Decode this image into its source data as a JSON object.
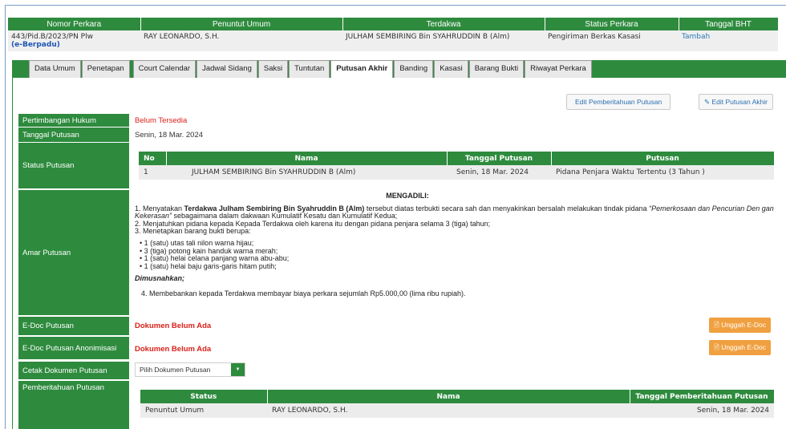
{
  "case": {
    "headers": [
      "Nomor Perkara",
      "Penuntut Umum",
      "Terdakwa",
      "Status Perkara",
      "Tanggal BHT"
    ],
    "nomor": "443/Pid.B/2023/PN Plw",
    "nomor_tag": "(e-Berpadu)",
    "penuntut": "RAY LEONARDO, S.H.",
    "terdakwa": "JULHAM SEMBIRING Bin SYAHRUDDIN B (Alm)",
    "status": "Pengiriman Berkas Kasasi",
    "bht_link": "Tambah"
  },
  "tabs": [
    "Data Umum",
    "Penetapan",
    "Court Calendar",
    "Jadwal Sidang",
    "Saksi",
    "Tuntutan",
    "Putusan Akhir",
    "Banding",
    "Kasasi",
    "Barang Bukti",
    "Riwayat Perkara"
  ],
  "buttons": {
    "edit_pemberitahuan": "Edit Pemberitahuan Putusan",
    "edit_putusan": "✎ Edit Putusan Akhir",
    "unggah": "🗎 Unggah E-Doc"
  },
  "labels": {
    "pertimbangan": "Pertimbangan Hukum",
    "tanggal": "Tanggal Putusan",
    "status": "Status Putusan",
    "amar": "Amar Putusan",
    "edoc": "E-Doc Putusan",
    "edoc_anon": "E-Doc Putusan Anonimisasi",
    "cetak": "Cetak Dokumen Putusan",
    "pemberitahuan": "Pemberitahuan Putusan"
  },
  "values": {
    "pertimbangan": "Belum Tersedia",
    "tanggal": "Senin, 18 Mar. 2024",
    "edoc": "Dokumen Belum Ada",
    "edoc_anon": "Dokumen Belum Ada",
    "cetak_select": "Pilih Dokumen Putusan"
  },
  "status_table": {
    "headers": [
      "No",
      "Nama",
      "Tanggal Putusan",
      "Putusan"
    ],
    "row": [
      "1",
      "JULHAM SEMBIRING Bin SYAHRUDDIN B (Alm)",
      "Senin, 18 Mar. 2024",
      "Pidana Penjara Waktu Tertentu (3 Tahun )"
    ]
  },
  "amar": {
    "heading": "MENGADILI:",
    "p1_a": "1. Menyatakan ",
    "p1_b": "Terdakwa Julham Sembiring Bin Syahruddin B (Alm)",
    "p1_c": " tersebut diatas terbukti secara sah dan menyakinkan bersalah melakukan tindak pidana ",
    "p1_d": "“Pemerkosaan dan Pencurian Den gan Kekerasan”",
    "p1_e": " sebagaimana dalam dakwaan Kumulatif Kesatu dan Kumulatif Kedua;",
    "p2": "2. Menjatuhkan pidana kepada Kepada Terdakwa oleh karena itu dengan pidana penjara selama 3 (tiga) tahun;",
    "p3": "3. Menetapkan barang bukti berupa:",
    "items": [
      "• 1 (satu) utas tali nilon warna hijau;",
      "• 3 (tiga) potong kain handuk warna merah;",
      "• 1 (satu) helai celana panjang warna abu-abu;",
      "• 1 (satu) helai baju garis-garis hitam putih;"
    ],
    "dimusnahkan": "Dimusnahkan;",
    "p4": "4. Membebankan kepada Terdakwa membayar biaya perkara sejumlah Rp5.000,00 (lima ribu rupiah)."
  },
  "pemberitahuan_table": {
    "headers": [
      "Status",
      "Nama",
      "Tanggal Pemberitahuan Putusan"
    ],
    "row": [
      "Penuntut Umum",
      "RAY LEONARDO, S.H.",
      "Senin, 18 Mar. 2024"
    ]
  },
  "colors": {
    "green": "#2e8b3e",
    "orange": "#f0a040",
    "red": "#d9211a"
  }
}
